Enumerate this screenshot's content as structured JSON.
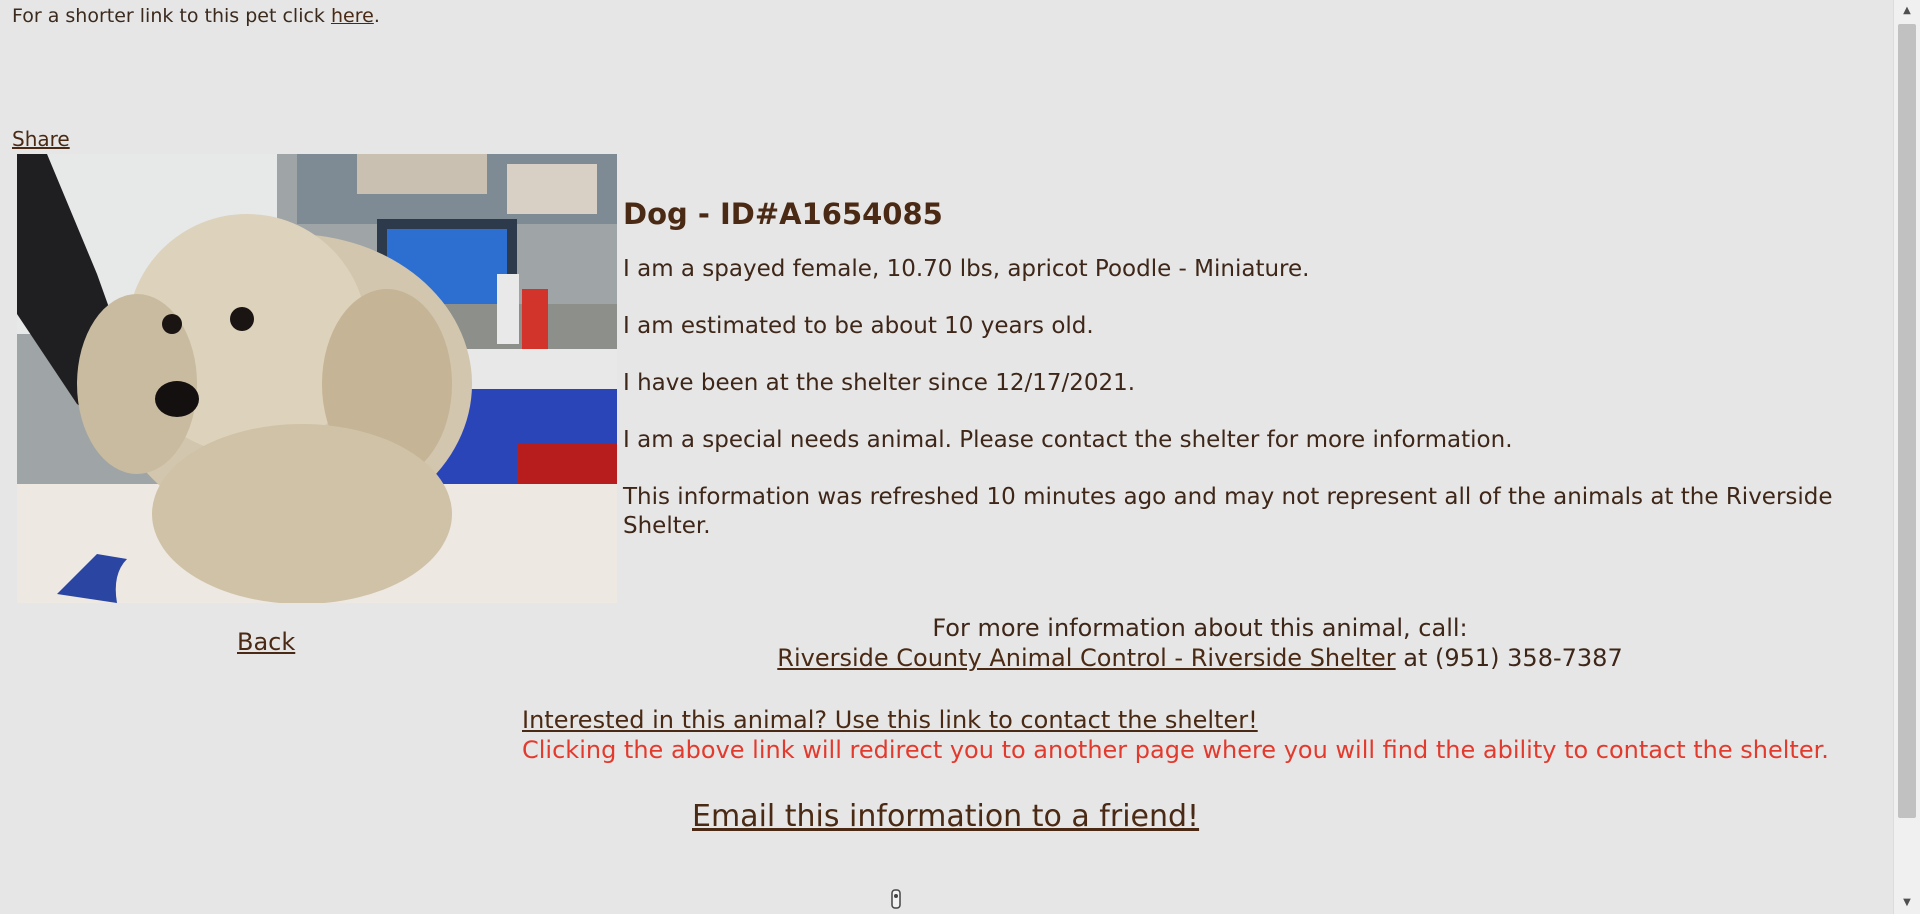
{
  "header": {
    "shortlink_prefix": "For a shorter link to this pet click ",
    "shortlink_link": "here",
    "shortlink_suffix": ".",
    "share_label": "Share"
  },
  "pet": {
    "title": "Dog - ID#A1654085",
    "description": "I am a spayed female, 10.70 lbs, apricot Poodle - Miniature.",
    "age": "I am estimated to be about 10 years old.",
    "shelter_since": "I have been at the shelter since 12/17/2021.",
    "special_needs": "I am a special needs animal. Please contact the shelter for more information.",
    "refresh_note": "This information was refreshed 10 minutes ago and may not represent all of the animals at the Riverside Shelter."
  },
  "navigation": {
    "back_label": "Back"
  },
  "contact": {
    "intro": "For more information about this animal, call:",
    "shelter_link": "Riverside County Animal Control - Riverside Shelter",
    "phone_text": " at (951) 358-7387",
    "interested_link": "Interested in this animal? Use this link to contact the shelter!",
    "redirect_note": "Clicking the above link will redirect you to another page where you will find the ability to contact the shelter.",
    "email_link": "Email this information to a friend!"
  },
  "colors": {
    "background": "#e6e6e6",
    "text": "#4a2a14",
    "warning": "#e23b2e"
  }
}
